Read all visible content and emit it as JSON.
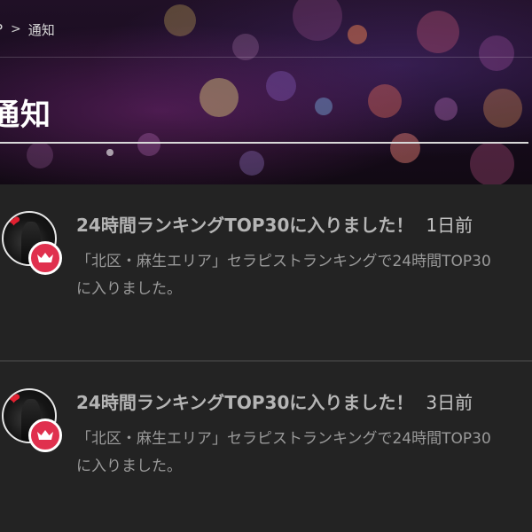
{
  "breadcrumb": {
    "home": "P",
    "separator": ">",
    "current": "通知"
  },
  "page_title": "通知",
  "notifications": [
    {
      "title": "24時間ランキングTOP30に入りました！",
      "time": "1日前",
      "body": "「北区・麻生エリア」セラピストランキングで24時間TOP30に入りました。",
      "avatar_icon": "profile-photo",
      "badge_icon": "crown-icon"
    },
    {
      "title": "24時間ランキングTOP30に入りました！",
      "time": "3日前",
      "body": "「北区・麻生エリア」セラピストランキングで24時間TOP30に入りました。",
      "avatar_icon": "profile-photo",
      "badge_icon": "crown-icon"
    }
  ],
  "colors": {
    "accent": "#e0304e",
    "list_bg": "#232323",
    "title_text": "#ffffff"
  }
}
